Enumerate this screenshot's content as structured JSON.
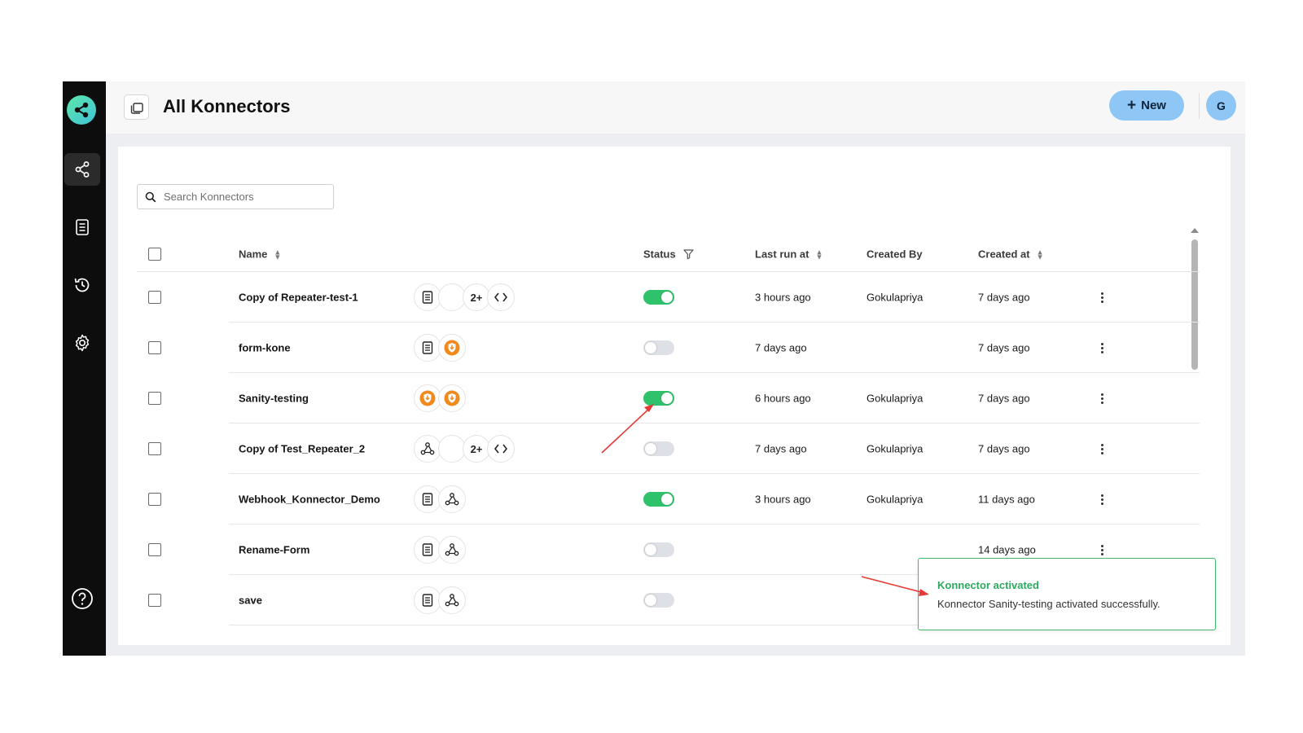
{
  "app": {
    "title": "All Konnectors"
  },
  "sidebar": {
    "items": [
      {
        "name": "konnectors",
        "icon": "share-nodes-icon",
        "active": true
      },
      {
        "name": "forms",
        "icon": "document-icon",
        "active": false
      },
      {
        "name": "history",
        "icon": "history-icon",
        "active": false
      },
      {
        "name": "settings",
        "icon": "gear-icon",
        "active": false
      }
    ],
    "help_icon": "help-icon"
  },
  "header": {
    "new_button_label": "New",
    "avatar_initial": "G"
  },
  "search": {
    "placeholder": "Search Konnectors",
    "value": ""
  },
  "table": {
    "columns": {
      "name": "Name",
      "status": "Status",
      "last_run": "Last run at",
      "created_by": "Created By",
      "created_at": "Created at"
    },
    "rows": [
      {
        "name": "Copy of Repeater-test-1",
        "apps": [
          "document-icon",
          "blank",
          "2+",
          "code-icon"
        ],
        "status": "on",
        "last_run": "3 hours ago",
        "created_by": "Gokulapriya",
        "created_at": "7 days ago"
      },
      {
        "name": "form-kone",
        "apps": [
          "document-icon",
          "orange-shield-icon"
        ],
        "status": "off",
        "last_run": "7 days ago",
        "created_by": "",
        "created_at": "7 days ago"
      },
      {
        "name": "Sanity-testing",
        "apps": [
          "orange-shield-icon",
          "orange-shield-icon"
        ],
        "status": "on",
        "last_run": "6 hours ago",
        "created_by": "Gokulapriya",
        "created_at": "7 days ago"
      },
      {
        "name": "Copy of Test_Repeater_2",
        "apps": [
          "webhook-icon",
          "blank",
          "2+",
          "code-icon"
        ],
        "status": "off",
        "last_run": "7 days ago",
        "created_by": "Gokulapriya",
        "created_at": "7 days ago"
      },
      {
        "name": "Webhook_Konnector_Demo",
        "apps": [
          "document-icon",
          "webhook-icon"
        ],
        "status": "on",
        "last_run": "3 hours ago",
        "created_by": "Gokulapriya",
        "created_at": "11 days ago"
      },
      {
        "name": "Rename-Form",
        "apps": [
          "document-icon",
          "webhook-icon"
        ],
        "status": "off",
        "last_run": "",
        "created_by": "",
        "created_at": "14 days ago"
      },
      {
        "name": "save",
        "apps": [
          "document-icon",
          "webhook-icon"
        ],
        "status": "off",
        "last_run": "",
        "created_by": "",
        "created_at": ""
      }
    ]
  },
  "toast": {
    "title": "Konnector activated",
    "message": "Konnector Sanity-testing activated successfully."
  },
  "colors": {
    "sidebar_bg": "#0d0d0d",
    "accent_blue": "#8ec6f5",
    "toggle_on": "#2fc26a",
    "toast_border": "#3bbd6b",
    "orange_app": "#f08a1c",
    "annotation_arrow": "#e53935"
  }
}
